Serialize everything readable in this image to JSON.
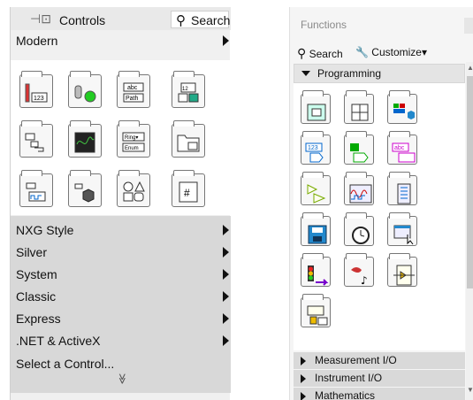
{
  "controls": {
    "title": "Controls",
    "search_label": "Search",
    "modern_label": "Modern",
    "icons": [
      "numeric-icon",
      "boolean-icon",
      "string-path-icon",
      "array-matrix-cluster-icon",
      "list-table-tree-icon",
      "graph-icon",
      "ring-enum-icon",
      "containers-icon",
      "io-icon",
      "variant-class-icon",
      "decorations-icon",
      "refnum-icon"
    ],
    "categories": [
      "NXG Style",
      "Silver",
      "System",
      "Classic",
      "Express",
      ".NET & ActiveX",
      "Select a Control..."
    ],
    "more_glyph": "≫"
  },
  "functions": {
    "title": "Functions",
    "search_label": "Search",
    "customize_label": "Customize▾",
    "section_label": "Programming",
    "icons": [
      "structures-icon",
      "array-icon",
      "cluster-class-variant-icon",
      "numeric-icon",
      "boolean-icon",
      "string-icon",
      "comparison-icon",
      "timing-icon",
      "dialog-ui-icon",
      "file-io-icon",
      "waveform-icon",
      "application-control-icon",
      "synchronization-icon",
      "graphics-sound-icon",
      "report-generation-icon",
      "data-communication-icon"
    ],
    "categories": [
      "Measurement I/O",
      "Instrument I/O",
      "Mathematics"
    ]
  }
}
